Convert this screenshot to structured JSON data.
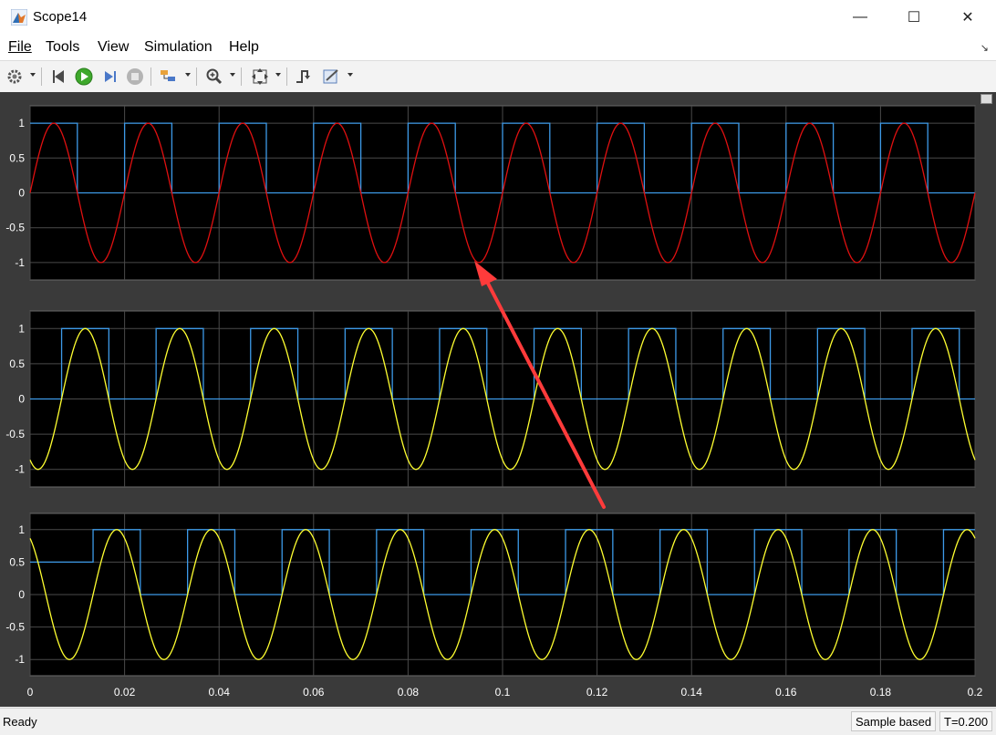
{
  "window": {
    "title": "Scope14"
  },
  "menu": [
    "File",
    "Tools",
    "View",
    "Simulation",
    "Help"
  ],
  "toolbar": {
    "icons": [
      "gear-icon",
      "run-back-icon",
      "run-icon",
      "step-forward-icon",
      "stop-icon",
      "highlight-icon",
      "zoom-in-icon",
      "fit-axes-icon",
      "triggers-icon",
      "style-icon"
    ]
  },
  "status": {
    "left": "Ready",
    "mode": "Sample based",
    "time": "T=0.200"
  },
  "colors": {
    "background": "#000000",
    "axes_bg": "#3a3a3a",
    "grid": "#4a4a4a",
    "square": "#3d9ae8",
    "sine_red": "#e01010",
    "sine_yellow": "#ffff30",
    "annotation": "#ff3b3b"
  },
  "chart_data": [
    {
      "type": "line",
      "title": "",
      "xlim": [
        0,
        0.2
      ],
      "ylim": [
        -1.25,
        1.25
      ],
      "yticks": [
        "1",
        "0.5",
        "0",
        "-0.5",
        "-1"
      ],
      "yticks_values": [
        1,
        0.5,
        0,
        -0.5,
        -1
      ],
      "grid": true,
      "series": [
        {
          "kind": "square",
          "color": "#3d9ae8",
          "period": 0.02,
          "duty": 0.5,
          "phase": 0,
          "amplitude": 1,
          "initial_value": null
        },
        {
          "kind": "sine",
          "color": "#e01010",
          "frequency": 50,
          "amplitude": 1,
          "phase_deg": 0
        }
      ]
    },
    {
      "type": "line",
      "title": "",
      "xlim": [
        0,
        0.2
      ],
      "ylim": [
        -1.25,
        1.25
      ],
      "yticks": [
        "1",
        "0.5",
        "0",
        "-0.5",
        "-1"
      ],
      "yticks_values": [
        1,
        0.5,
        0,
        -0.5,
        -1
      ],
      "grid": true,
      "series": [
        {
          "kind": "square",
          "color": "#3d9ae8",
          "period": 0.02,
          "duty": 0.5,
          "phase": 0.00667,
          "amplitude": 1,
          "initial_value": 0
        },
        {
          "kind": "sine",
          "color": "#ffff30",
          "frequency": 50,
          "amplitude": 1,
          "phase_deg": -120
        }
      ]
    },
    {
      "type": "line",
      "title": "",
      "xlim": [
        0,
        0.2
      ],
      "ylim": [
        -1.25,
        1.25
      ],
      "yticks": [
        "1",
        "0.5",
        "0",
        "-0.5",
        "-1"
      ],
      "yticks_values": [
        1,
        0.5,
        0,
        -0.5,
        -1
      ],
      "xticks": [
        "0",
        "0.02",
        "0.04",
        "0.06",
        "0.08",
        "0.1",
        "0.12",
        "0.14",
        "0.16",
        "0.18",
        "0.2"
      ],
      "xticks_values": [
        0,
        0.02,
        0.04,
        0.06,
        0.08,
        0.1,
        0.12,
        0.14,
        0.16,
        0.18,
        0.2
      ],
      "grid": true,
      "series": [
        {
          "kind": "square",
          "color": "#3d9ae8",
          "period": 0.02,
          "duty": 0.5,
          "phase": 0.01333,
          "amplitude": 1,
          "initial_value": 0.5
        },
        {
          "kind": "sine",
          "color": "#ffff30",
          "frequency": 50,
          "amplitude": 1,
          "phase_deg": 120
        }
      ]
    }
  ]
}
